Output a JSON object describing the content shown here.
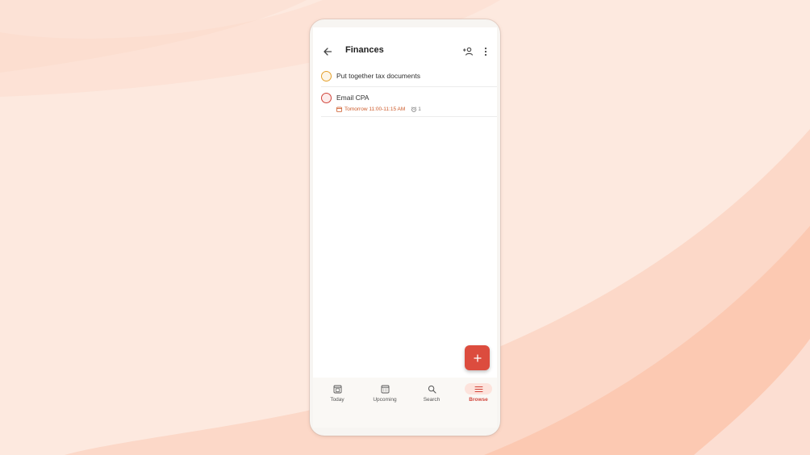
{
  "header": {
    "title": "Finances"
  },
  "tasks": [
    {
      "label": "Put together tax documents",
      "priority_color": "#e5a02a"
    },
    {
      "label": "Email CPA",
      "priority_color": "#d1453b",
      "due": "Tomorrow 11:00-11:15 AM",
      "reminders": "1"
    }
  ],
  "nav": {
    "items": [
      {
        "label": "Today"
      },
      {
        "label": "Upcoming"
      },
      {
        "label": "Search"
      },
      {
        "label": "Browse",
        "active": true
      }
    ]
  },
  "colors": {
    "accent": "#dc4c3e",
    "background": "#fde9df",
    "due_text": "#cd5b2b"
  }
}
